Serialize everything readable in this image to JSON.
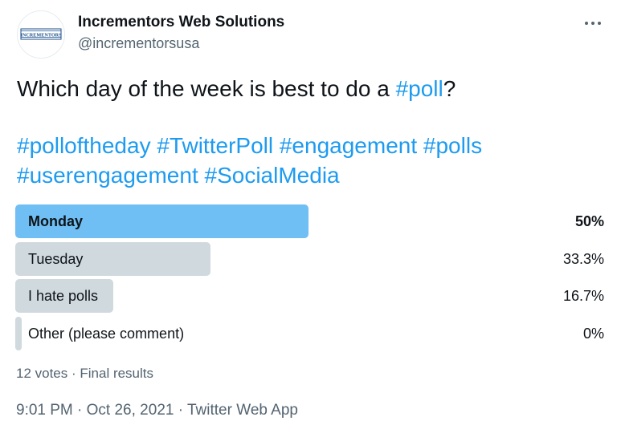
{
  "tweet": {
    "author": {
      "name": "Incrementors Web Solutions",
      "handle": "@incrementorsusa",
      "avatar_text": "INCREMENTORS",
      "avatar_icon": "brand-logo-icon"
    },
    "more_icon": "more-options-icon",
    "text": {
      "question_prefix": "Which day of the week is best to do a ",
      "question_hashtag": "#poll",
      "question_suffix": "?",
      "hashtags": [
        "#polloftheday",
        "#TwitterPoll",
        "#engagement",
        "#polls",
        "#userengagement",
        "#SocialMedia"
      ]
    },
    "poll": {
      "options": [
        {
          "label": "Monday",
          "percent_text": "50%",
          "percent": 50,
          "winner": true
        },
        {
          "label": "Tuesday",
          "percent_text": "33.3%",
          "percent": 33.3,
          "winner": false
        },
        {
          "label": "I hate polls",
          "percent_text": "16.7%",
          "percent": 16.7,
          "winner": false
        },
        {
          "label": "Other (please comment)",
          "percent_text": "0%",
          "percent": 0,
          "winner": false
        }
      ],
      "votes": "12 votes",
      "separator": " · ",
      "status": "Final results"
    },
    "time": "9:01 PM",
    "date": "Oct 26, 2021",
    "source": "Twitter Web App",
    "separator": " · "
  },
  "colors": {
    "text_primary": "#0f1419",
    "text_secondary": "#536471",
    "hashtag": "#1d9bf0",
    "poll_winner_bar": "#6fbff5",
    "poll_bar": "#cfd9de",
    "brand": "#1b4f8c"
  }
}
